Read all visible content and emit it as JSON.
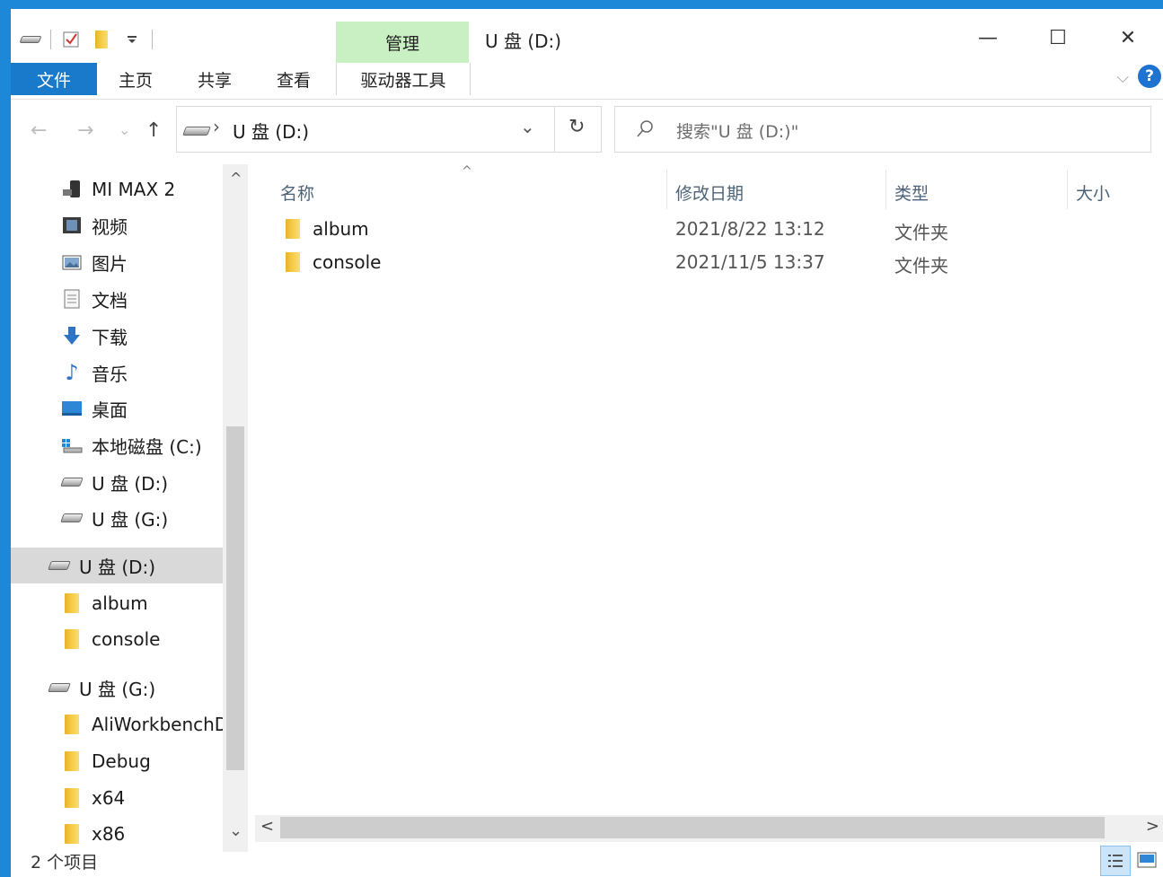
{
  "window": {
    "title": "U 盘 (D:)",
    "context_group": "管理",
    "minimize_glyph": "—",
    "maximize_glyph": "☐",
    "close_glyph": "✕"
  },
  "ribbon": {
    "tabs": [
      {
        "label": "文件"
      },
      {
        "label": "主页"
      },
      {
        "label": "共享"
      },
      {
        "label": "查看"
      },
      {
        "label": "驱动器工具"
      }
    ],
    "help_glyph": "?",
    "expand_glyph": "⌵"
  },
  "navigation": {
    "back_glyph": "←",
    "forward_glyph": "→",
    "recent_glyph": "⌄",
    "up_glyph": "↑",
    "path_separator": "›",
    "path": "U 盘 (D:)",
    "dropdown_glyph": "⌄",
    "refresh_glyph": "↻",
    "search_placeholder": "搜索\"U 盘 (D:)\""
  },
  "sidebar": {
    "items": [
      {
        "label": "MI MAX 2",
        "icon": "phone-icon"
      },
      {
        "label": "视频",
        "icon": "video-icon"
      },
      {
        "label": "图片",
        "icon": "pictures-icon"
      },
      {
        "label": "文档",
        "icon": "documents-icon"
      },
      {
        "label": "下载",
        "icon": "download-icon"
      },
      {
        "label": "音乐",
        "icon": "music-icon"
      },
      {
        "label": "桌面",
        "icon": "desktop-icon"
      },
      {
        "label": "本地磁盘 (C:)",
        "icon": "local-disk-icon"
      },
      {
        "label": "U 盘 (D:)",
        "icon": "usb-drive-icon"
      },
      {
        "label": "U 盘 (G:)",
        "icon": "usb-drive-icon"
      },
      {
        "label": "U 盘 (D:)",
        "icon": "usb-drive-icon",
        "selected": true
      },
      {
        "label": "album",
        "icon": "folder-icon"
      },
      {
        "label": "console",
        "icon": "folder-icon"
      },
      {
        "label": "U 盘 (G:)",
        "icon": "usb-drive-icon"
      },
      {
        "label": "AliWorkbenchD",
        "icon": "folder-icon"
      },
      {
        "label": "Debug",
        "icon": "folder-icon"
      },
      {
        "label": "x64",
        "icon": "folder-icon"
      },
      {
        "label": "x86",
        "icon": "folder-icon"
      }
    ],
    "scroll_up_glyph": "^",
    "scroll_down_glyph": "⌄"
  },
  "file_list": {
    "columns": [
      "名称",
      "修改日期",
      "类型",
      "大小"
    ],
    "sort_glyph": "^",
    "rows": [
      {
        "name": "album",
        "modified": "2021/8/22 13:12",
        "type": "文件夹",
        "size": ""
      },
      {
        "name": "console",
        "modified": "2021/11/5 13:37",
        "type": "文件夹",
        "size": ""
      }
    ],
    "scroll_left_glyph": "<",
    "scroll_right_glyph": ">"
  },
  "status_bar": {
    "item_count": "2 个项目"
  },
  "colors": {
    "accent": "#1e88d8",
    "file_tab": "#1979ca",
    "context_tab": "#c9f0c2",
    "folder": "#f4c542",
    "selected_row": "#d9d9d9"
  }
}
